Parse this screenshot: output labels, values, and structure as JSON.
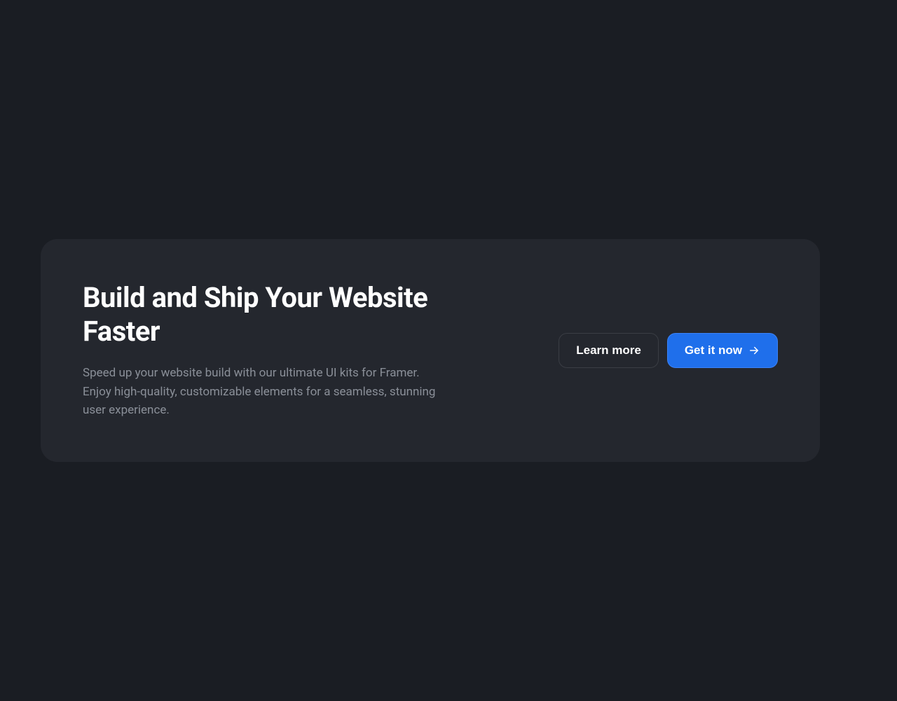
{
  "cta": {
    "heading": "Build and Ship Your Website Faster",
    "description": "Speed up your website build with our ultimate UI kits for Framer. Enjoy high-quality, customizable elements for a seamless, stunning user experience.",
    "secondary_button_label": "Learn more",
    "primary_button_label": "Get it now"
  },
  "colors": {
    "background": "#1a1d23",
    "card_background": "#24272e",
    "primary_button": "#1f6feb",
    "text_primary": "#ffffff",
    "text_secondary": "#8a8f98"
  }
}
